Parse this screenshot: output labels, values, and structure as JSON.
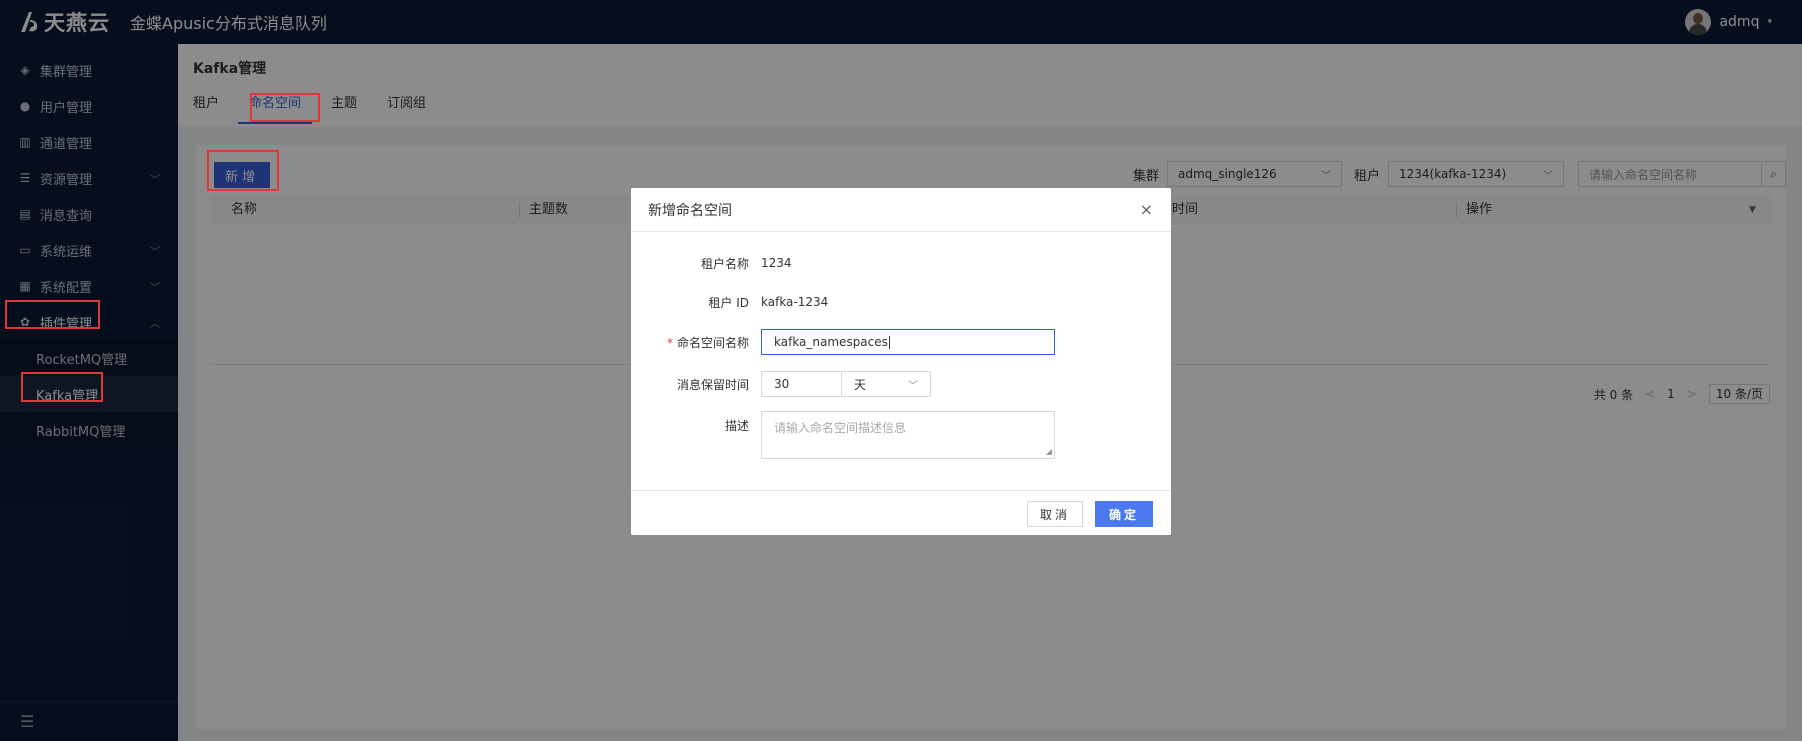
{
  "header": {
    "brand": "天燕云",
    "app_title": "金蝶Apusic分布式消息队列",
    "user": "admq",
    "caret": "▾"
  },
  "sidebar": {
    "items": [
      {
        "label": "集群管理",
        "icon": "cube-icon",
        "glyph": "◈",
        "arrow": ""
      },
      {
        "label": "用户管理",
        "icon": "user-icon",
        "glyph": "●",
        "arrow": ""
      },
      {
        "label": "通道管理",
        "icon": "channel-icon",
        "glyph": "▥",
        "arrow": ""
      },
      {
        "label": "资源管理",
        "icon": "resource-icon",
        "glyph": "☰",
        "arrow": "﹀"
      },
      {
        "label": "消息查询",
        "icon": "query-icon",
        "glyph": "▤",
        "arrow": ""
      },
      {
        "label": "系统运维",
        "icon": "ops-icon",
        "glyph": "▭",
        "arrow": "﹀"
      },
      {
        "label": "系统配置",
        "icon": "config-icon",
        "glyph": "▦",
        "arrow": "﹀"
      },
      {
        "label": "插件管理",
        "icon": "plugin-icon",
        "glyph": "✿",
        "arrow": "︿"
      }
    ],
    "sub_items": [
      "RocketMQ管理",
      "Kafka管理",
      "RabbitMQ管理"
    ],
    "collapse_glyph": "☰"
  },
  "page": {
    "title": "Kafka管理",
    "tabs": [
      "租户",
      "命名空间",
      "主题",
      "订阅组"
    ]
  },
  "toolbar": {
    "add_label": "新增",
    "cluster_label": "集群",
    "cluster_value": "admq_single126",
    "tenant_label": "租户",
    "tenant_value": "1234(kafka-1234)",
    "search_placeholder": "请输入命名空间名称",
    "chevron": "﹀",
    "search_glyph": "⌕"
  },
  "table": {
    "columns": [
      "名称",
      "主题数",
      "建时间",
      "操作"
    ],
    "filter_glyph": "▼"
  },
  "pager": {
    "total": "共 0 条",
    "prev": "<",
    "page": "1",
    "next": ">",
    "size": "10 条/页"
  },
  "modal": {
    "title": "新增命名空间",
    "close": "×",
    "tenant_name_label": "租户名称",
    "tenant_name_value": "1234",
    "tenant_id_label": "租户 ID",
    "tenant_id_value": "kafka-1234",
    "ns_label": "命名空间名称",
    "required_mark": "*",
    "ns_value": "kafka_namespaces",
    "retention_label": "消息保留时间",
    "retention_value": "30",
    "retention_unit": "天",
    "desc_label": "描述",
    "desc_placeholder": "请输入命名空间描述信息",
    "cancel_label": "取消",
    "ok_label": "确定"
  },
  "colors": {
    "primary": "#3561d8",
    "nav_bg": "#0c1a36",
    "highlight": "#e0383a"
  }
}
